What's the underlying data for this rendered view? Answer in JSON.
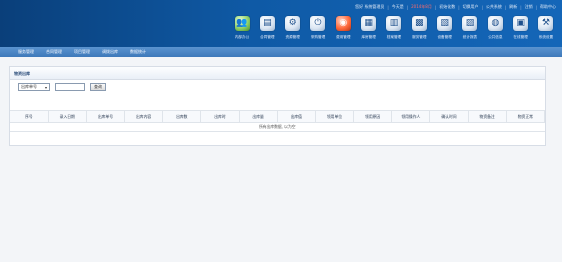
{
  "header": {
    "links": [
      "您好 系统管理员",
      "今天是",
      "2014年8月",
      "初始化数",
      "切换用户",
      "公共系统",
      "刷新",
      "注销",
      "帮助中心"
    ],
    "modules": [
      {
        "label": "内部办公",
        "icon": "people-icon",
        "glyph": "👥",
        "style": "green"
      },
      {
        "label": "合同管理",
        "icon": "document-icon",
        "glyph": "▤",
        "style": ""
      },
      {
        "label": "资源管理",
        "icon": "gear-icon",
        "glyph": "⚙",
        "style": ""
      },
      {
        "label": "采购管理",
        "icon": "power-icon",
        "glyph": "⏻",
        "style": ""
      },
      {
        "label": "费用管理",
        "icon": "target-icon",
        "glyph": "◉",
        "style": "red"
      },
      {
        "label": "库房管理",
        "icon": "file-icon",
        "glyph": "▦",
        "style": ""
      },
      {
        "label": "档案管理",
        "icon": "book-icon",
        "glyph": "▥",
        "style": ""
      },
      {
        "label": "服务管理",
        "icon": "cabinet-icon",
        "glyph": "▩",
        "style": ""
      },
      {
        "label": "设备管理",
        "icon": "chart-icon",
        "glyph": "▧",
        "style": ""
      },
      {
        "label": "统计报表",
        "icon": "report-icon",
        "glyph": "▨",
        "style": ""
      },
      {
        "label": "公共信息",
        "icon": "globe-icon",
        "glyph": "◍",
        "style": ""
      },
      {
        "label": "在线管理",
        "icon": "monitor-icon",
        "glyph": "▣",
        "style": ""
      },
      {
        "label": "系统设置",
        "icon": "tools-icon",
        "glyph": "⚒",
        "style": ""
      }
    ]
  },
  "nav": {
    "items": [
      "服务管理",
      "合同管理",
      "项目管理",
      "调拨出库",
      "数据统计"
    ]
  },
  "panel": {
    "title": "物资出库",
    "search_select_value": "出库单号",
    "query_label": "查询",
    "columns": [
      "序号",
      "录入日期",
      "出库单号",
      "出库内容",
      "出库数",
      "出库时",
      "出库量",
      "出库值",
      "领用单位",
      "领用原因",
      "领用操作人",
      "确认时间",
      "物资备注",
      "物资正常"
    ],
    "empty_message": "所有出库数据, 以为空"
  }
}
